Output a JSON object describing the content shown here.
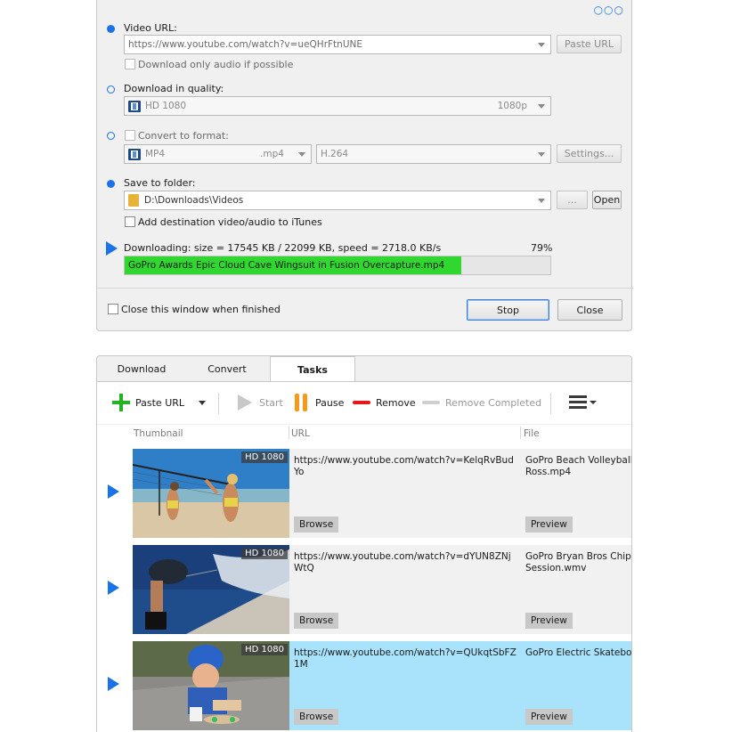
{
  "dialog": {
    "video_url_label": "Video URL:",
    "video_url_value": "https://www.youtube.com/watch?v=ueQHrFtnUNE",
    "paste_url_button": "Paste URL",
    "audio_only_label": "Download only audio if possible",
    "quality_label": "Download in quality:",
    "quality_value": "HD 1080",
    "quality_res": "1080p",
    "convert_label": "Convert to format:",
    "format_value": "MP4",
    "format_ext": ".mp4",
    "codec_value": "H.264",
    "settings_button": "Settings...",
    "save_label": "Save to folder:",
    "folder_value": "D:\\Downloads\\Videos",
    "browse_button": "...",
    "open_button": "Open",
    "itunes_label": "Add destination video/audio to iTunes",
    "status_text": "Downloading: size = 17545 KB / 22099 KB, speed = 2718.0 KB/s",
    "percent_text": "79%",
    "progress": 0.79,
    "progress_filename": "GoPro Awards  Epic Cloud Cave Wingsuit in Fusion Overcapture.mp4",
    "close_when_finished": "Close this window when finished",
    "stop_button": "Stop",
    "close_button": "Close"
  },
  "tabs": [
    "Download",
    "Convert",
    "Tasks"
  ],
  "toolbar": {
    "paste_url": "Paste URL",
    "start": "Start",
    "pause": "Pause",
    "remove": "Remove",
    "remove_completed": "Remove Completed"
  },
  "columns": {
    "thumbnail": "Thumbnail",
    "url": "URL",
    "file": "File"
  },
  "rows": [
    {
      "badge": "HD 1080",
      "url": "https://www.youtube.com/watch?v=KelqRvBudYo",
      "file_line1": "GoPro  Beach Volleyball w",
      "file_line2": "Ross.mp4",
      "browse": "Browse",
      "preview": "Preview"
    },
    {
      "badge": "HD 1080",
      "url": "https://www.youtube.com/watch?v=dYUN8ZNjWtQ",
      "file_line1": "GoPro  Bryan Bros Chip T",
      "file_line2": "Session.wmv",
      "browse": "Browse",
      "preview": "Preview"
    },
    {
      "badge": "HD 1080",
      "url": "https://www.youtube.com/watch?v=QUkqtSbFZ1M",
      "file_line1": "GoPro  Electric Skateboar",
      "file_line2": "",
      "browse": "Browse",
      "preview": "Preview"
    }
  ],
  "colors": {
    "accent": "#1a73e8",
    "progress": "#2fd72f",
    "selected_row": "#a9e3fb",
    "add": "#22b422",
    "pause": "#f59a1c",
    "remove": "#e8161b"
  }
}
